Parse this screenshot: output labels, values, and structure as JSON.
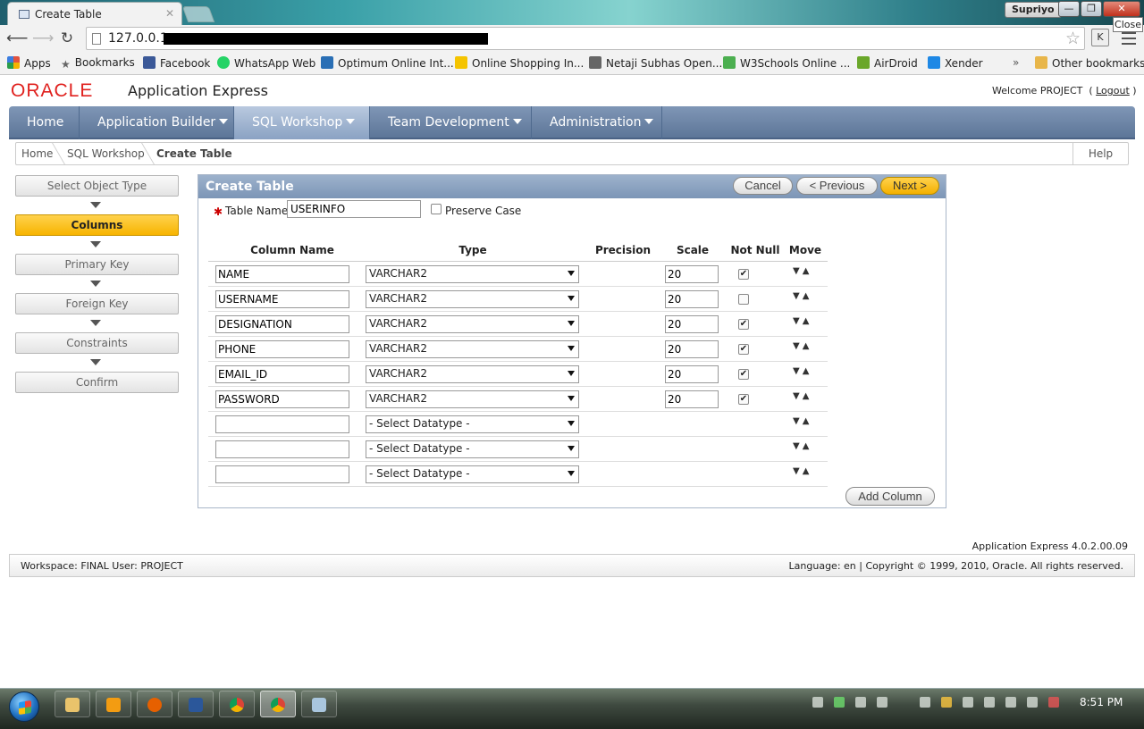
{
  "browser": {
    "tab_title": "Create Table",
    "tab_close": "✕",
    "user": "Supriyo",
    "close_tooltip": "Close",
    "url": "127.0.0.1",
    "bookmarks": [
      {
        "label": "Apps",
        "icon": "apps-grid-icon",
        "color": "#e2533f"
      },
      {
        "label": "Bookmarks",
        "icon": "star-icon",
        "color": "#888888"
      },
      {
        "label": "Facebook",
        "icon": "facebook-icon",
        "color": "#3b5998"
      },
      {
        "label": "WhatsApp Web",
        "icon": "whatsapp-icon",
        "color": "#25d366"
      },
      {
        "label": "Optimum Online Int...",
        "icon": "optimum-icon",
        "color": "#2a6fb5"
      },
      {
        "label": "Online Shopping In...",
        "icon": "flipkart-icon",
        "color": "#f5c400"
      },
      {
        "label": "Netaji Subhas Open...",
        "icon": "university-icon",
        "color": "#555555"
      },
      {
        "label": "W3Schools Online ...",
        "icon": "w3schools-icon",
        "color": "#4caf50"
      },
      {
        "label": "AirDroid",
        "icon": "airdroid-icon",
        "color": "#6aa72a"
      },
      {
        "label": "Xender",
        "icon": "xender-icon",
        "color": "#1e88e5"
      }
    ],
    "more": "»",
    "other_bookmarks": "Other bookmarks"
  },
  "header": {
    "logo": "ORACLE",
    "product": "Application Express",
    "welcome": "Welcome PROJECT",
    "logout": "Logout"
  },
  "tabs": [
    {
      "label": "Home",
      "dropdown": false
    },
    {
      "label": "Application Builder",
      "dropdown": true
    },
    {
      "label": "SQL Workshop",
      "dropdown": true
    },
    {
      "label": "Team Development",
      "dropdown": true
    },
    {
      "label": "Administration",
      "dropdown": true
    }
  ],
  "breadcrumb": [
    "Home",
    "SQL Workshop",
    "Create Table"
  ],
  "help": "Help",
  "steps": [
    "Select Object Type",
    "Columns",
    "Primary Key",
    "Foreign Key",
    "Constraints",
    "Confirm"
  ],
  "panel": {
    "title": "Create Table",
    "cancel": "Cancel",
    "previous": "< Previous",
    "next": "Next >",
    "table_name_label": "Table Name",
    "table_name_value": "USERINFO",
    "preserve_case": "Preserve Case",
    "headers": {
      "column_name": "Column Name",
      "type": "Type",
      "precision": "Precision",
      "scale": "Scale",
      "not_null": "Not Null",
      "move": "Move"
    },
    "rows": [
      {
        "name": "NAME",
        "type": "VARCHAR2",
        "scale": "20",
        "not_null": true
      },
      {
        "name": "USERNAME",
        "type": "VARCHAR2",
        "scale": "20",
        "not_null": false
      },
      {
        "name": "DESIGNATION",
        "type": "VARCHAR2",
        "scale": "20",
        "not_null": true
      },
      {
        "name": "PHONE",
        "type": "VARCHAR2",
        "scale": "20",
        "not_null": true
      },
      {
        "name": "EMAIL_ID",
        "type": "VARCHAR2",
        "scale": "20",
        "not_null": true
      },
      {
        "name": "PASSWORD",
        "type": "VARCHAR2",
        "scale": "20",
        "not_null": true
      },
      {
        "name": "",
        "type": "- Select Datatype -",
        "scale": null,
        "not_null": null
      },
      {
        "name": "",
        "type": "- Select Datatype -",
        "scale": null,
        "not_null": null
      },
      {
        "name": "",
        "type": "- Select Datatype -",
        "scale": null,
        "not_null": null
      }
    ],
    "move_glyphs": "▼▲",
    "add_column": "Add Column"
  },
  "footer": {
    "version": "Application Express 4.0.2.00.09",
    "workspace": "Workspace: FINAL User: PROJECT",
    "copyright": "Language: en | Copyright © 1999, 2010, Oracle. All rights reserved."
  },
  "taskbar": {
    "clock": "8:51 PM"
  },
  "colors": {
    "oracle_red": "#e0221f",
    "tab_blue": "#6a82a5",
    "active_step": "#f7b400",
    "panel_header": "#8aa1c0"
  }
}
